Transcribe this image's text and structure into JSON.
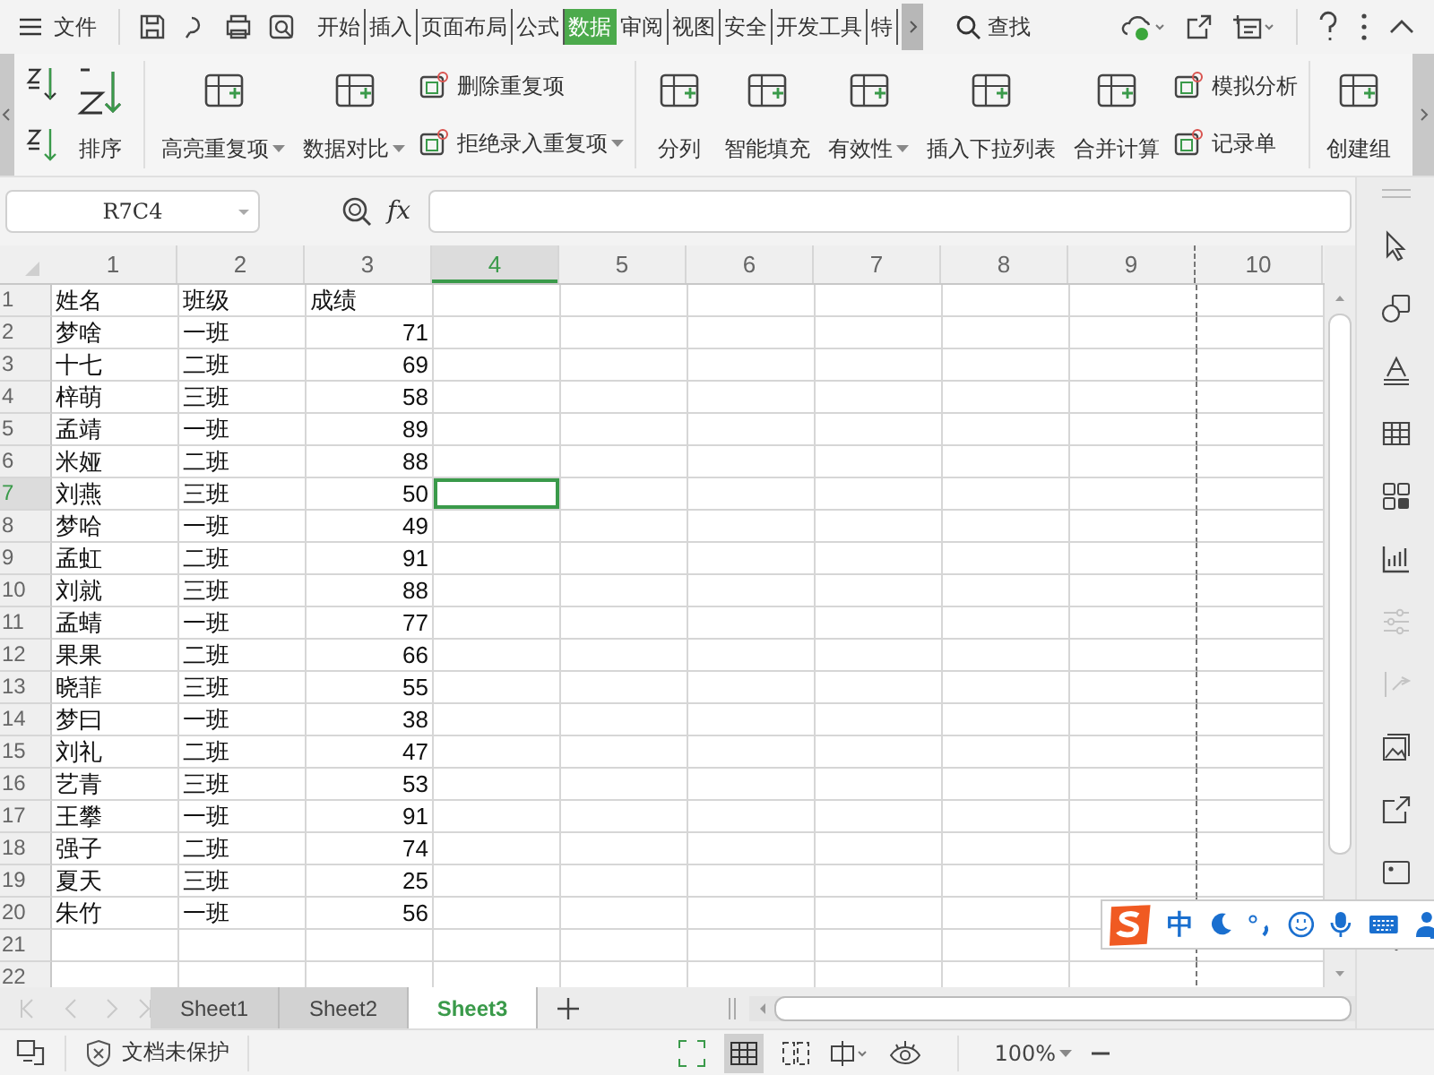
{
  "menu": {
    "label": "文件"
  },
  "ribbon_tabs": [
    {
      "label": "开始",
      "selected": false
    },
    {
      "label": "插入",
      "selected": false
    },
    {
      "label": "页面布局",
      "selected": false
    },
    {
      "label": "公式",
      "selected": false
    },
    {
      "label": "数据",
      "selected": true
    },
    {
      "label": "审阅",
      "selected": false
    },
    {
      "label": "视图",
      "selected": false
    },
    {
      "label": "安全",
      "selected": false
    },
    {
      "label": "开发工具",
      "selected": false
    },
    {
      "label": "特",
      "selected": false
    }
  ],
  "search": {
    "label": "查找"
  },
  "ribbon": {
    "groups": [
      {
        "items": [
          {
            "kind": "sort",
            "label": "排序"
          }
        ]
      },
      {
        "items": [
          {
            "kind": "large",
            "label": "高亮重复项",
            "dropdown": true
          },
          {
            "kind": "large",
            "label": "数据对比",
            "dropdown": true
          },
          {
            "kind": "stack",
            "items": [
              {
                "label": "删除重复项",
                "dropdown": false
              },
              {
                "label": "拒绝录入重复项",
                "dropdown": true
              }
            ]
          }
        ]
      },
      {
        "items": [
          {
            "kind": "large",
            "label": "分列",
            "dropdown": false
          },
          {
            "kind": "large",
            "label": "智能填充",
            "dropdown": false
          },
          {
            "kind": "large",
            "label": "有效性",
            "dropdown": true
          },
          {
            "kind": "large",
            "label": "插入下拉列表",
            "dropdown": false
          },
          {
            "kind": "large",
            "label": "合并计算",
            "dropdown": false
          },
          {
            "kind": "stack",
            "items": [
              {
                "label": "模拟分析",
                "dropdown": false
              },
              {
                "label": "记录单",
                "dropdown": false
              }
            ]
          }
        ]
      },
      {
        "items": [
          {
            "kind": "large",
            "label": "创建组",
            "dropdown": false
          }
        ]
      }
    ]
  },
  "name_box": {
    "value": "R7C4"
  },
  "formula_bar": {
    "fx_label": "fx"
  },
  "sheet": {
    "columns": [
      {
        "label": "1",
        "selected": false,
        "numeric": false
      },
      {
        "label": "2",
        "selected": false,
        "numeric": false
      },
      {
        "label": "3",
        "selected": false,
        "numeric": true
      },
      {
        "label": "4",
        "selected": true,
        "numeric": false
      },
      {
        "label": "5",
        "selected": false,
        "numeric": false
      },
      {
        "label": "6",
        "selected": false,
        "numeric": false
      },
      {
        "label": "7",
        "selected": false,
        "numeric": false
      },
      {
        "label": "8",
        "selected": false,
        "numeric": false
      },
      {
        "label": "9",
        "selected": false,
        "numeric": false
      },
      {
        "label": "10",
        "selected": false,
        "numeric": false
      }
    ],
    "rows": [
      {
        "label": "1",
        "selected": false,
        "kind": "header",
        "cells": [
          "姓名",
          "班级",
          "成绩"
        ]
      },
      {
        "label": "2",
        "selected": false,
        "kind": "data",
        "cells": [
          "梦啥",
          "一班",
          "71"
        ]
      },
      {
        "label": "3",
        "selected": false,
        "kind": "data",
        "cells": [
          "十七",
          "二班",
          "69"
        ]
      },
      {
        "label": "4",
        "selected": false,
        "kind": "data",
        "cells": [
          "梓萌",
          "三班",
          "58"
        ]
      },
      {
        "label": "5",
        "selected": false,
        "kind": "data",
        "cells": [
          "孟靖",
          "一班",
          "89"
        ]
      },
      {
        "label": "6",
        "selected": false,
        "kind": "data",
        "cells": [
          "米娅",
          "二班",
          "88"
        ]
      },
      {
        "label": "7",
        "selected": true,
        "kind": "data",
        "cells": [
          "刘燕",
          "三班",
          "50"
        ]
      },
      {
        "label": "8",
        "selected": false,
        "kind": "data",
        "cells": [
          "梦哈",
          "一班",
          "49"
        ]
      },
      {
        "label": "9",
        "selected": false,
        "kind": "data",
        "cells": [
          "孟虹",
          "二班",
          "91"
        ]
      },
      {
        "label": "10",
        "selected": false,
        "kind": "data",
        "cells": [
          "刘就",
          "三班",
          "88"
        ]
      },
      {
        "label": "11",
        "selected": false,
        "kind": "data",
        "cells": [
          "孟蜻",
          "一班",
          "77"
        ]
      },
      {
        "label": "12",
        "selected": false,
        "kind": "data",
        "cells": [
          "果果",
          "二班",
          "66"
        ]
      },
      {
        "label": "13",
        "selected": false,
        "kind": "data",
        "cells": [
          "晓菲",
          "三班",
          "55"
        ]
      },
      {
        "label": "14",
        "selected": false,
        "kind": "data",
        "cells": [
          "梦曰",
          "一班",
          "38"
        ]
      },
      {
        "label": "15",
        "selected": false,
        "kind": "data",
        "cells": [
          "刘礼",
          "二班",
          "47"
        ]
      },
      {
        "label": "16",
        "selected": false,
        "kind": "data",
        "cells": [
          "艺青",
          "三班",
          "53"
        ]
      },
      {
        "label": "17",
        "selected": false,
        "kind": "data",
        "cells": [
          "王攀",
          "一班",
          "91"
        ]
      },
      {
        "label": "18",
        "selected": false,
        "kind": "data",
        "cells": [
          "强子",
          "二班",
          "74"
        ]
      },
      {
        "label": "19",
        "selected": false,
        "kind": "data",
        "cells": [
          "夏天",
          "三班",
          "25"
        ]
      },
      {
        "label": "20",
        "selected": false,
        "kind": "data",
        "cells": [
          "朱竹",
          "一班",
          "56"
        ]
      },
      {
        "label": "21",
        "selected": false,
        "kind": "data",
        "cells": []
      },
      {
        "label": "22",
        "selected": false,
        "kind": "data",
        "cells": []
      }
    ]
  },
  "sheet_tabs": [
    {
      "label": "Sheet1",
      "selected": false
    },
    {
      "label": "Sheet2",
      "selected": false
    },
    {
      "label": "Sheet3",
      "selected": true
    }
  ],
  "status_bar": {
    "protection": "文档未保护",
    "zoom": "100%"
  },
  "ime_bar": {
    "mode": "中"
  }
}
